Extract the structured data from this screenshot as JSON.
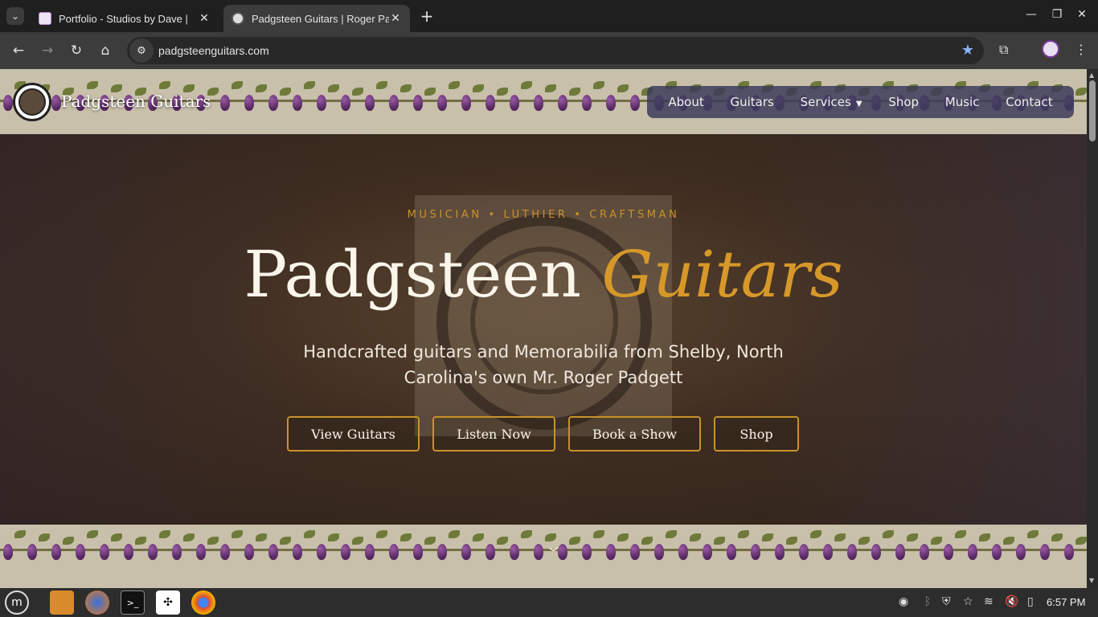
{
  "browser": {
    "tabs": [
      {
        "title": "Portfolio - Studios by Dave |",
        "active": false
      },
      {
        "title": "Padgsteen Guitars | Roger Pa",
        "active": true
      }
    ],
    "url": "padgsteenguitars.com"
  },
  "site": {
    "brand_name": "Padgsteen Guitars",
    "nav": [
      "About",
      "Guitars",
      "Services",
      "Shop",
      "Music",
      "Contact"
    ],
    "hero": {
      "eyebrow": "MUSICIAN • LUTHIER • CRAFTSMAN",
      "title_part1": "Padgsteen",
      "title_part2": "Guitars",
      "subtitle": "Handcrafted guitars and Memorabilia from Shelby, North Carolina's own Mr. Roger Padgett",
      "buttons": [
        "View Guitars",
        "Listen Now",
        "Book a Show",
        "Shop"
      ]
    }
  },
  "taskbar": {
    "time": "6:57 PM"
  },
  "colors": {
    "accent_gold": "#c9922a",
    "nav_bg": "#3c3c5a",
    "star_blue": "#8ab4f8"
  }
}
